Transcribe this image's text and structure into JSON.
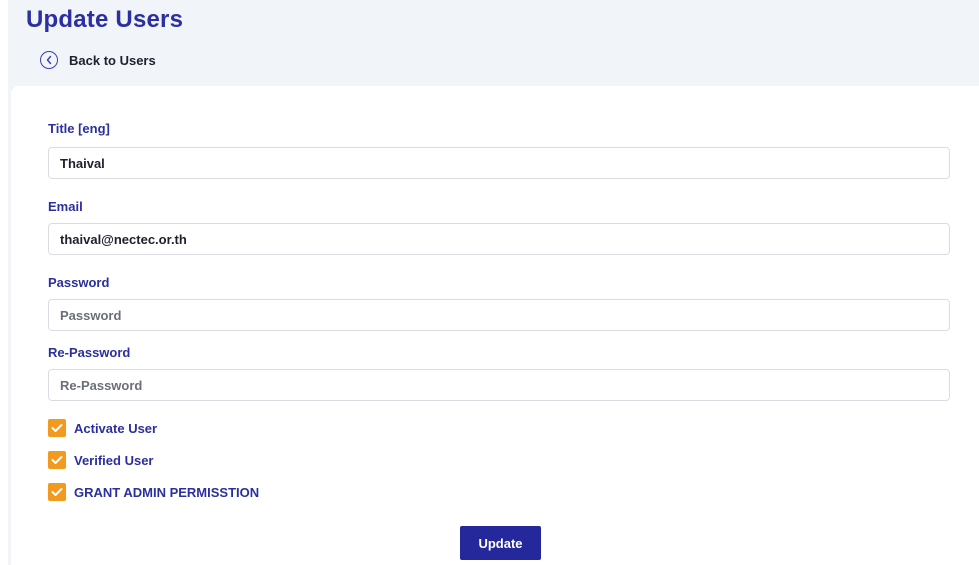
{
  "page": {
    "title": "Update Users",
    "back_label": "Back to Users"
  },
  "icons": {
    "back": "chevron-left-circle-icon",
    "check": "checkmark-icon"
  },
  "form": {
    "title_eng": {
      "label": "Title [eng]",
      "value": "Thaival"
    },
    "email": {
      "label": "Email",
      "value": "thaival@nectec.or.th"
    },
    "password": {
      "label": "Password",
      "placeholder": "Password"
    },
    "re_password": {
      "label": "Re-Password",
      "placeholder": "Re-Password"
    },
    "checkboxes": [
      {
        "label": "Activate User",
        "checked": true
      },
      {
        "label": "Verified User",
        "checked": true
      },
      {
        "label": "GRANT ADMIN PERMISSTION",
        "checked": true
      }
    ],
    "submit_label": "Update"
  },
  "colors": {
    "accent": "#2b2fa0",
    "button": "#25289a",
    "checkbox": "#f29a1f",
    "page_background": "#f1f4f9"
  }
}
